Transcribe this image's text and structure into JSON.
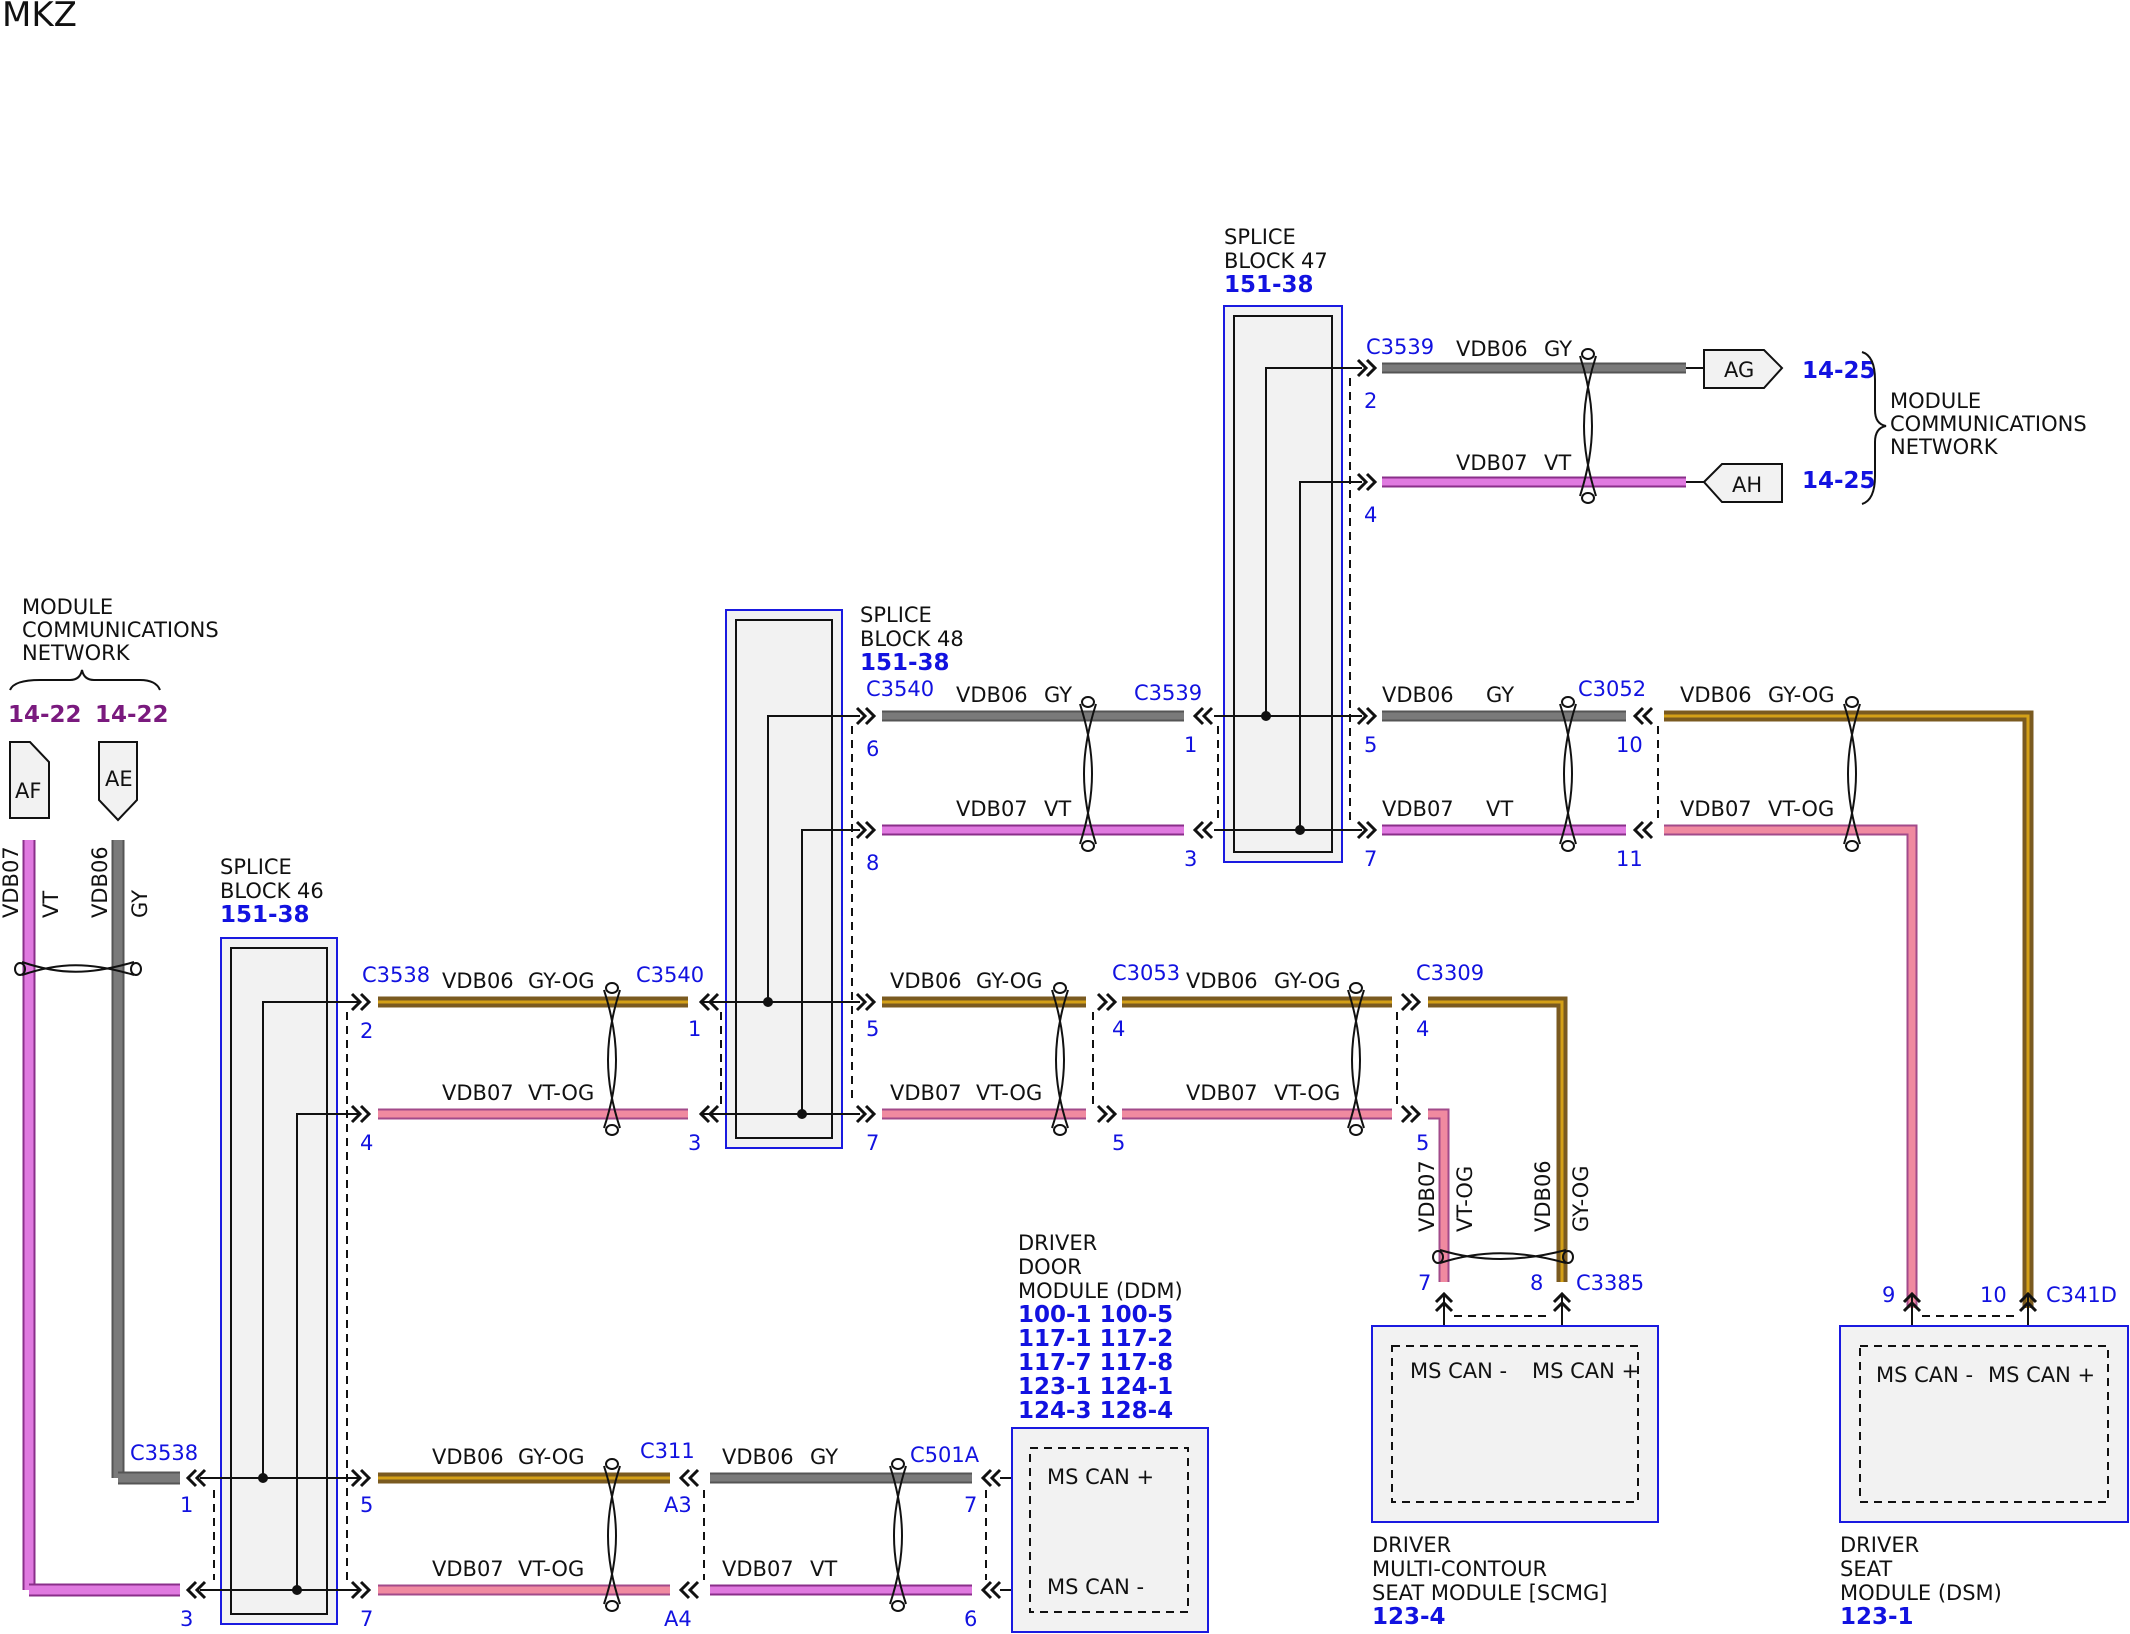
{
  "page": {
    "title": "MKZ"
  },
  "diagram": {
    "header_left": {
      "network_label": [
        "MODULE",
        "COMMUNICATIONS",
        "NETWORK"
      ],
      "refs": [
        "14-22",
        "14-22"
      ]
    },
    "header_right": {
      "network_label": [
        "MODULE",
        "COMMUNICATIONS",
        "NETWORK"
      ],
      "refs": [
        "14-25",
        "14-25"
      ]
    },
    "splice_blocks": [
      {
        "title": [
          "SPLICE",
          "BLOCK 46"
        ],
        "ref": "151-38"
      },
      {
        "title": [
          "SPLICE",
          "BLOCK 48"
        ],
        "ref": "151-38"
      },
      {
        "title": [
          "SPLICE",
          "BLOCK 47"
        ],
        "ref": "151-38"
      }
    ],
    "tags": [
      "AF",
      "AE",
      "AG",
      "AH"
    ],
    "connectors": [
      "C3538",
      "C3540",
      "C3539",
      "C3052",
      "C3053",
      "C3309",
      "C311",
      "C501A",
      "C3385",
      "C341D"
    ],
    "pins": [
      "1",
      "2",
      "3",
      "4",
      "5",
      "6",
      "7",
      "8",
      "9",
      "10",
      "11",
      "A3",
      "A4"
    ],
    "circuits": [
      "VDB06",
      "VDB07",
      "GY",
      "VT",
      "GY-OG",
      "VT-OG"
    ],
    "modules": [
      {
        "name": [
          "DRIVER",
          "DOOR",
          "MODULE (DDM)"
        ],
        "refs": [
          "100-1 100-5",
          "117-1 117-2",
          "117-7 117-8",
          "123-1 124-1",
          "124-3 128-4"
        ],
        "pins": [
          "MS CAN +",
          "MS CAN -"
        ]
      },
      {
        "name": [
          "DRIVER",
          "MULTI-CONTOUR",
          "SEAT MODULE [SCMG]"
        ],
        "refs": [
          "123-4"
        ],
        "pins": [
          "MS CAN -",
          "MS CAN +"
        ]
      },
      {
        "name": [
          "DRIVER",
          "SEAT",
          "MODULE (DSM)"
        ],
        "refs": [
          "123-1"
        ],
        "pins": [
          "MS CAN -",
          "MS CAN +"
        ]
      }
    ],
    "colors": {
      "gray_wire": "#7a7a7a",
      "violet_wire": "#e07ae0",
      "orange_tracer": "#d4a017",
      "pink_tracer": "#f08aa0",
      "ref_blue": "#1212e0",
      "ref_purple": "#7a1a7e"
    }
  }
}
